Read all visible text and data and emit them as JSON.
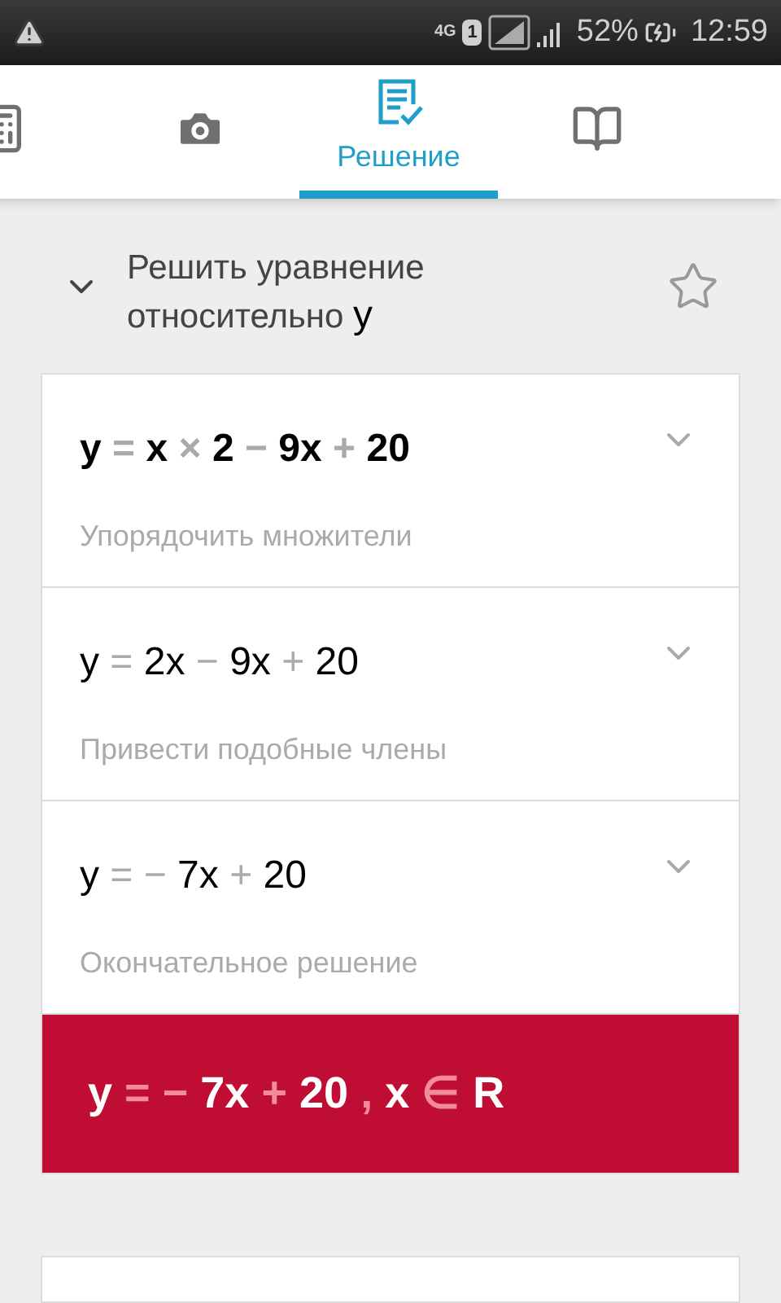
{
  "status_bar": {
    "network": "4G",
    "sim": "1",
    "battery": "52%",
    "time": "12:59"
  },
  "tabs": [
    {
      "kind": "calculator",
      "selected": false
    },
    {
      "kind": "camera",
      "selected": false
    },
    {
      "kind": "solution",
      "label": "Решение",
      "selected": true
    },
    {
      "kind": "book",
      "selected": false
    }
  ],
  "header": {
    "title": "Решить уравнение относительно",
    "variable": "y",
    "expanded": true,
    "starred": false
  },
  "steps": [
    {
      "bold": true,
      "expanded": false,
      "description": "Упорядочить множители",
      "tokens": [
        {
          "kind": "term",
          "text": "y"
        },
        {
          "kind": "op",
          "text": "="
        },
        {
          "kind": "term",
          "text": "x"
        },
        {
          "kind": "op",
          "text": "×"
        },
        {
          "kind": "term",
          "text": "2"
        },
        {
          "kind": "op",
          "text": "−"
        },
        {
          "kind": "term",
          "text": "9x"
        },
        {
          "kind": "op",
          "text": "+"
        },
        {
          "kind": "term",
          "text": "20"
        }
      ]
    },
    {
      "bold": false,
      "expanded": false,
      "description": "Привести подобные члены",
      "tokens": [
        {
          "kind": "term",
          "text": "y"
        },
        {
          "kind": "op",
          "text": "="
        },
        {
          "kind": "term",
          "text": "2x"
        },
        {
          "kind": "op",
          "text": "−"
        },
        {
          "kind": "term",
          "text": "9x"
        },
        {
          "kind": "op",
          "text": "+"
        },
        {
          "kind": "term",
          "text": "20"
        }
      ]
    },
    {
      "bold": false,
      "expanded": false,
      "description": "Окончательное решение",
      "tokens": [
        {
          "kind": "term",
          "text": "y"
        },
        {
          "kind": "op",
          "text": "="
        },
        {
          "kind": "op",
          "text": "−"
        },
        {
          "kind": "term",
          "text": "7x"
        },
        {
          "kind": "op",
          "text": "+"
        },
        {
          "kind": "term",
          "text": "20"
        }
      ]
    }
  ],
  "result": {
    "tokens": [
      {
        "kind": "term",
        "text": "y"
      },
      {
        "kind": "op",
        "text": "="
      },
      {
        "kind": "op",
        "text": "−"
      },
      {
        "kind": "term",
        "text": "7x"
      },
      {
        "kind": "op",
        "text": "+"
      },
      {
        "kind": "term",
        "text": "20"
      },
      {
        "kind": "op",
        "text": ","
      },
      {
        "kind": "term",
        "text": "x"
      },
      {
        "kind": "op",
        "text": "∈"
      },
      {
        "kind": "term",
        "text": "R"
      }
    ]
  }
}
